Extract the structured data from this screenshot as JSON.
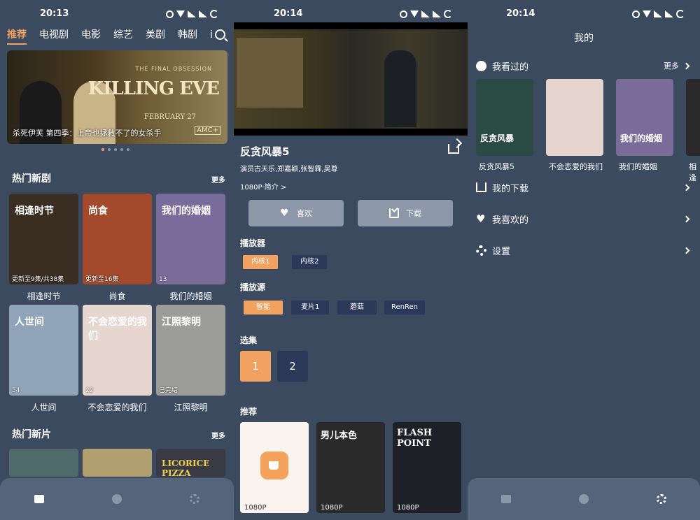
{
  "status": {
    "time1": "20:13",
    "time2": "20:14",
    "time3": "20:14"
  },
  "home": {
    "tabs": [
      "推荐",
      "电视剧",
      "电影",
      "综艺",
      "美剧",
      "韩剧",
      "i"
    ],
    "banner": {
      "tagline": "THE FINAL OBSESSION",
      "logo": "KILLING EVE",
      "date": "FEBRUARY 27",
      "network": "AMC+",
      "caption": "杀死伊芙 第四季：上帝也拯救不了的女杀手"
    },
    "section1": {
      "title": "热门新剧",
      "more": "更多"
    },
    "section2": {
      "title": "热门新片",
      "more": "更多"
    },
    "shows": [
      {
        "title": "相逢时节",
        "badge": "更新至9集/共38集",
        "bg": "#3a2e22",
        "art": "相逢时节"
      },
      {
        "title": "尚食",
        "badge": "更新至16集",
        "bg": "#a34a2c",
        "art": "尚食"
      },
      {
        "title": "我们的婚姻",
        "badge": "13",
        "bg": "#7a6c9a",
        "art": "我们的婚姻"
      },
      {
        "title": "人世间",
        "badge": "54",
        "bg": "#8fa4b8",
        "art": "人世间"
      },
      {
        "title": "不会恋爱的我们",
        "badge": "22",
        "bg": "#e6d6d0",
        "art": "不会恋爱的我们"
      },
      {
        "title": "江照黎明",
        "badge": "已完结",
        "bg": "#9c9c98",
        "art": "江照黎明"
      }
    ],
    "movies": [
      {
        "bg": "#4e6a6a",
        "art": ""
      },
      {
        "bg": "#b0a070",
        "art": ""
      },
      {
        "bg": "#3a3a46",
        "art": "LICORICE PIZZA"
      }
    ]
  },
  "detail": {
    "title": "反贪风暴5",
    "cast": "演员古天乐,郑嘉颖,张智霖,吴尊",
    "meta": "1080P·简介 >",
    "like": "喜欢",
    "download": "下载",
    "player_label": "播放器",
    "players": [
      "内核1",
      "内核2"
    ],
    "source_label": "播放源",
    "sources": [
      "智能",
      "麦片1",
      "蘑菇",
      "RenRen"
    ],
    "episode_label": "选集",
    "episodes": [
      "1",
      "2"
    ],
    "rec_label": "推荐",
    "recs": [
      {
        "badge": "1080P",
        "bg": "#fbf3ee",
        "art": ""
      },
      {
        "badge": "1080P",
        "bg": "#2a2a2a",
        "art": "男儿本色"
      },
      {
        "badge": "1080P",
        "bg": "#1e2028",
        "art": "FLASH POINT"
      }
    ]
  },
  "profile": {
    "title": "我的",
    "history_label": "我看过的",
    "history_more": "更多",
    "history": [
      {
        "title": "反贪风暴5",
        "bg": "#2c4a44",
        "art": "反贪风暴"
      },
      {
        "title": "不会恋爱的我们",
        "bg": "#e6d4cf",
        "art": ""
      },
      {
        "title": "我们的婚姻",
        "bg": "#7a6c9a",
        "art": "我们的婚姻"
      },
      {
        "title": "相逢",
        "bg": "#2a2a2a",
        "art": ""
      }
    ],
    "downloads": "我的下载",
    "likes": "我喜欢的",
    "settings": "设置"
  },
  "colors": {
    "accent": "#f2a260",
    "bg": "#3c4a60",
    "chip": "#2b3858",
    "nav": "#56647b"
  }
}
